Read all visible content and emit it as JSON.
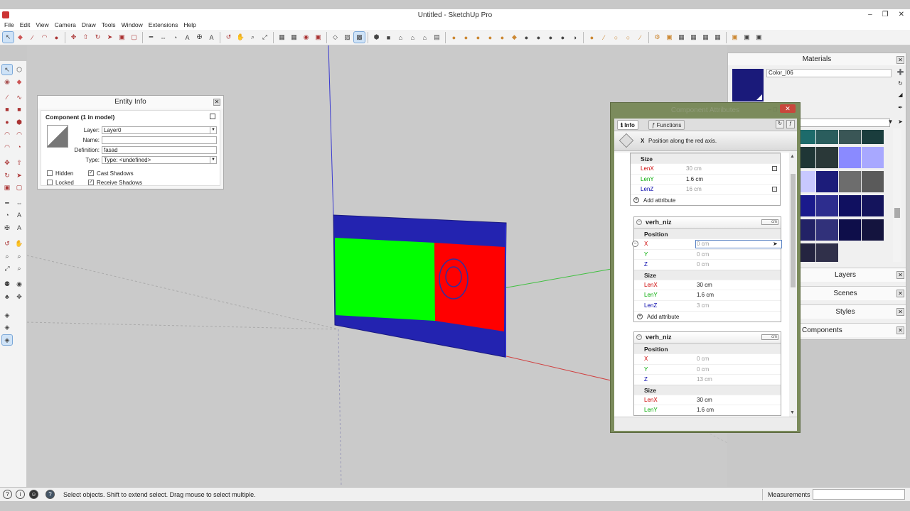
{
  "window": {
    "title": "Untitled - SketchUp Pro",
    "controls": [
      "–",
      "❐",
      "✕"
    ]
  },
  "menu": [
    "File",
    "Edit",
    "View",
    "Camera",
    "Draw",
    "Tools",
    "Window",
    "Extensions",
    "Help"
  ],
  "status": {
    "hint": "Select objects. Shift to extend select. Drag mouse to select multiple.",
    "measurements_label": "Measurements",
    "measurements_value": ""
  },
  "entity_info": {
    "title": "Entity Info",
    "heading": "Component (1 in model)",
    "layer_label": "Layer:",
    "layer_value": "Layer0",
    "name_label": "Name:",
    "name_value": "",
    "definition_label": "Definition:",
    "definition_value": "fasad",
    "type_label": "Type:",
    "type_value": "Type: <undefined>",
    "hidden_label": "Hidden",
    "hidden_checked": false,
    "locked_label": "Locked",
    "locked_checked": false,
    "cast_label": "Cast Shadows",
    "cast_checked": true,
    "receive_label": "Receive Shadows",
    "receive_checked": true
  },
  "component_attributes": {
    "title": "Component Attributes",
    "tab_info": "Info",
    "tab_functions": "Functions",
    "info_key": "X",
    "info_text": "Position along the red axis.",
    "top_block": {
      "size_label": "Size",
      "rows": [
        {
          "label": "LenX",
          "value": "30 cm"
        },
        {
          "label": "LenY",
          "value": "1.6 cm"
        },
        {
          "label": "LenZ",
          "value": "16 cm"
        }
      ],
      "add_attribute": "Add attribute"
    },
    "blocks": [
      {
        "name": "verh_niz",
        "unit": "cm",
        "position_label": "Position",
        "position": [
          {
            "label": "X",
            "value": "0 cm"
          },
          {
            "label": "Y",
            "value": "0 cm"
          },
          {
            "label": "Z",
            "value": "0 cm"
          }
        ],
        "size_label": "Size",
        "size": [
          {
            "label": "LenX",
            "value": "30 cm"
          },
          {
            "label": "LenY",
            "value": "1.6 cm"
          },
          {
            "label": "LenZ",
            "value": "3 cm"
          }
        ],
        "add_attribute": "Add attribute"
      },
      {
        "name": "verh_niz",
        "unit": "cm",
        "position_label": "Position",
        "position": [
          {
            "label": "X",
            "value": "0 cm"
          },
          {
            "label": "Y",
            "value": "0 cm"
          },
          {
            "label": "Z",
            "value": "13 cm"
          }
        ],
        "size_label": "Size",
        "size": [
          {
            "label": "LenX",
            "value": "30 cm"
          },
          {
            "label": "LenY",
            "value": "1.6 cm"
          }
        ]
      }
    ]
  },
  "materials": {
    "title": "Materials",
    "current_name": "Color_I06",
    "current_color": "#1a1a7a",
    "swatches": [
      "#1d6b6b",
      "#2a5d5d",
      "#3a5656",
      "#1a3d3d",
      "#1f3636",
      "#2a3838",
      "#8a8aff",
      "#a8a8ff",
      "#c8c8ff",
      "#1c1c7a",
      "#6d6d6d",
      "#5a5a5a",
      "#1a1a8c",
      "#2d2d8e",
      "#101060",
      "#14145c",
      "#222266",
      "#31317a",
      "#0e0e4a",
      "#14143e",
      "#242440",
      "#30304a"
    ],
    "sections": [
      "Layers",
      "Scenes",
      "Styles",
      "Components"
    ]
  },
  "model": {
    "frame_color": "#2323b0",
    "green_panel": "#00ff00",
    "red_panel": "#ff0000"
  }
}
